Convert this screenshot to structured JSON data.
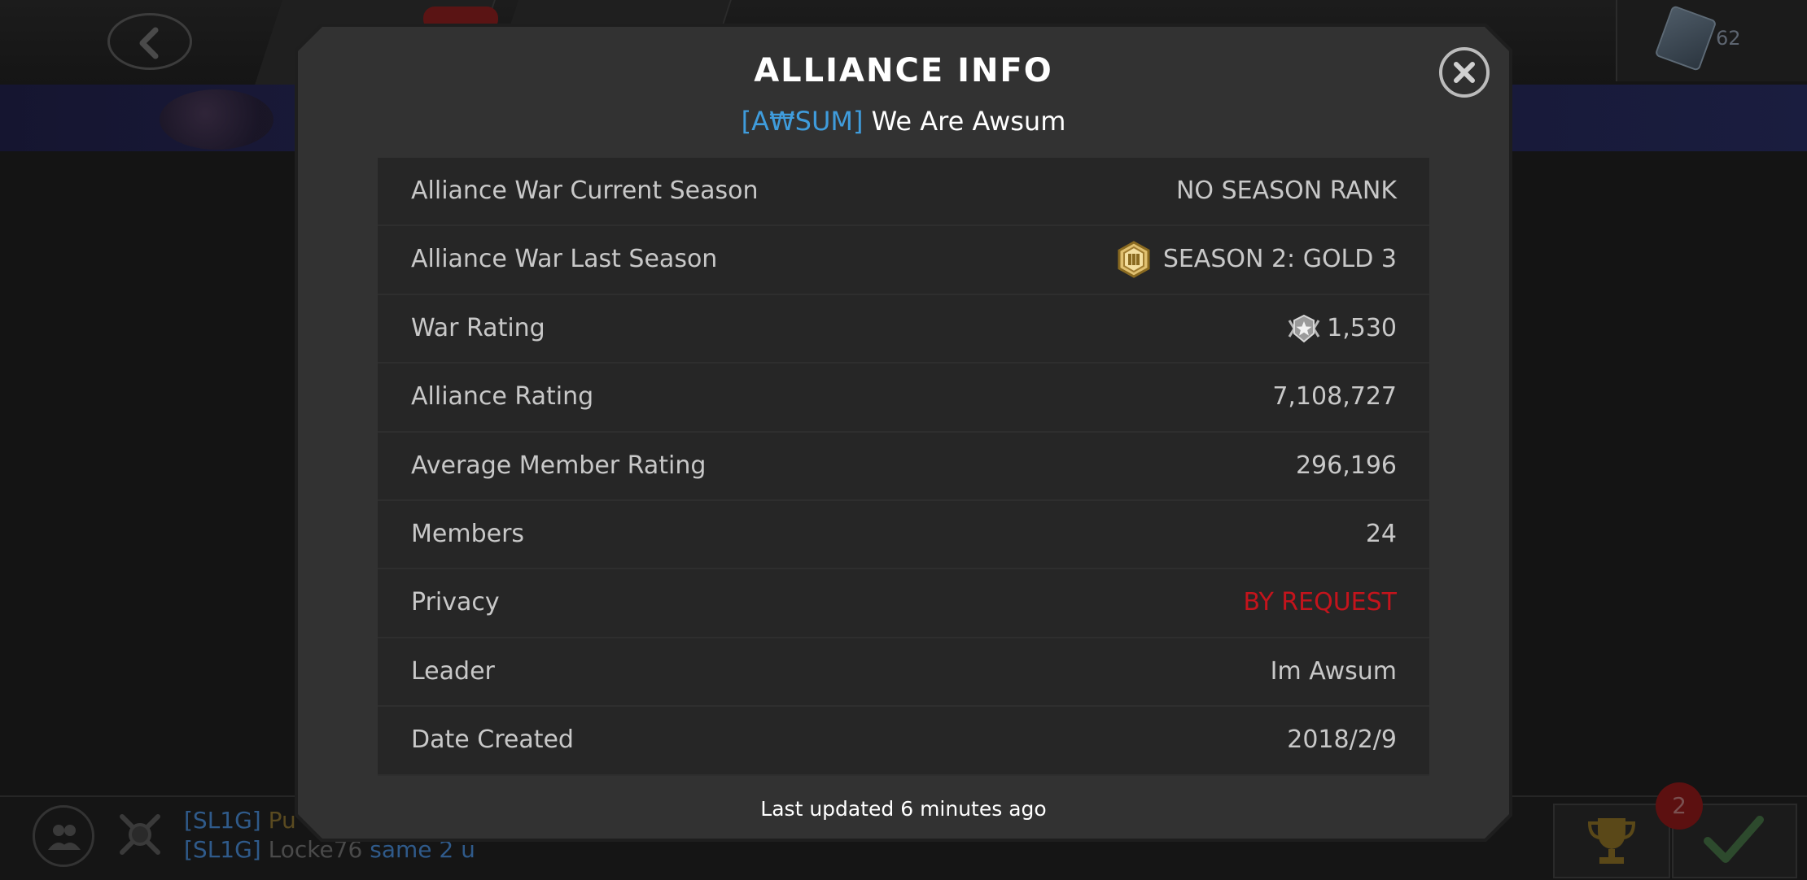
{
  "background": {
    "crystal_count": "62",
    "chat": [
      {
        "tag": "[SL1G]",
        "name": "Pu",
        "message": ""
      },
      {
        "tag": "[SL1G]",
        "name": "Locke76",
        "message": "same 2 u"
      }
    ],
    "notification_count": "2"
  },
  "modal": {
    "title": "ALLIANCE INFO",
    "alliance_tag": "[A₩SUM]",
    "alliance_name": "We Are Awsum",
    "rows": [
      {
        "label": "Alliance War Current Season",
        "value": "NO SEASON RANK"
      },
      {
        "label": "Alliance War Last Season",
        "value": "SEASON 2: GOLD 3",
        "icon": "gold-tier-badge-icon"
      },
      {
        "label": "War Rating",
        "value": "1,530",
        "icon": "war-rating-emblem-icon"
      },
      {
        "label": "Alliance Rating",
        "value": "7,108,727"
      },
      {
        "label": "Average Member Rating",
        "value": "296,196"
      },
      {
        "label": "Members",
        "value": "24"
      },
      {
        "label": "Privacy",
        "value": "BY REQUEST",
        "value_color": "#c4141c"
      },
      {
        "label": "Leader",
        "value": "Im Awsum"
      },
      {
        "label": "Date Created",
        "value": "2018/2/9"
      }
    ],
    "footer": "Last updated 6 minutes ago"
  },
  "colors": {
    "tag_blue": "#3f9cdc",
    "privacy_red": "#c4141c",
    "modal_bg": "#323232",
    "table_bg": "#262626"
  }
}
